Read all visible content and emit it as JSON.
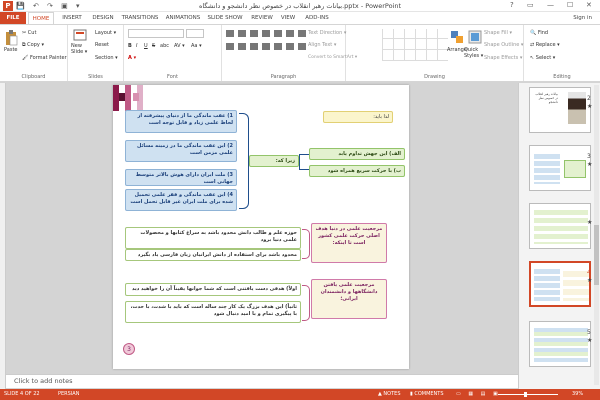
{
  "window": {
    "title": "بیانات رهبر انقلاب در خصوص نظر دانشجو و دانشگاه.pptx - PowerPoint",
    "quick_access": "💾 ↶ ↷ ▣ ▾",
    "controls": {
      "help": "?",
      "restore": "▭",
      "minimize": "—",
      "maximize": "☐",
      "close": "✕"
    },
    "user": "Sign in"
  },
  "tabs": [
    "FILE",
    "HOME",
    "INSERT",
    "DESIGN",
    "TRANSITIONS",
    "ANIMATIONS",
    "SLIDE SHOW",
    "REVIEW",
    "VIEW",
    "ADD-INS"
  ],
  "active_tab": "HOME",
  "ribbon": {
    "clipboard": {
      "label": "Clipboard",
      "paste": "Paste",
      "cut": "Cut",
      "copy": "Copy ▾",
      "format_painter": "Format Painter"
    },
    "slides": {
      "label": "Slides",
      "new_slide": "New Slide ▾",
      "layout": "Layout ▾",
      "reset": "Reset",
      "section": "Section ▾"
    },
    "font": {
      "label": "Font",
      "bold": "B",
      "italic": "I",
      "underline": "U",
      "strike": "S",
      "abc": "abc",
      "spacing": "AV ▾",
      "case": "Aa ▾",
      "color": "A ▾"
    },
    "paragraph": {
      "label": "Paragraph",
      "text_direction": "Text Direction ▾",
      "align_text": "Align Text ▾",
      "smartart": "Convert to SmartArt ▾"
    },
    "drawing": {
      "label": "Drawing",
      "arrange": "Arrange",
      "quick_styles": "Quick Styles ▾",
      "shape_fill": "Shape Fill ▾",
      "shape_outline": "Shape Outline ▾",
      "shape_effects": "Shape Effects ▾"
    },
    "editing": {
      "label": "Editing",
      "find": "Find",
      "replace": "Replace ▾",
      "select": "Select ▾"
    }
  },
  "slide": {
    "header": "لذا باید:",
    "center_label": "زیرا که:",
    "left_points": [
      "1) عقب ماندگی ما از دنیای پیشرفته از لحاظ علمی زیاد و قابل توجه است",
      "2) این عقب ماندگی ما در زمینه مسائل علمی مزمن است",
      "3) ملت ایران دارای هوش بالاتر متوسط جهانی است",
      "4) این عقب ماندگی و فقر علمی تحمیل شده برای ملت ایران غیر قابل تحمل است"
    ],
    "right_points": [
      "الف) این جهش تداوم یابد",
      "ب) با حرکت سریع همراه شود"
    ],
    "middle_text": "حوزه علم و طالب دانش محدود باشد به سراغ کتابها و محصولات علمی  دنیا برود",
    "middle_text_2": "محدود باشد برای استفاده از دانش ایرانیان زبان فارسی یاد بگیرد",
    "goal_1": "مرجعیت علمی در دنیا هدف اصلی حرکت علمی کشور است تا اینکه:",
    "lower_text_1": "اولاً) هدفی دست یافتنی است که شما جوانها یقیناً آن را خواهید دید",
    "lower_text_2": "ثانیاً) این هدف بزرگ یک کار چند ساله است که باید با شدت، با حدت، با پیگیری تمام و با امید دنبال شود",
    "goal_2": "مرجعیت علمی یافتن دانشگاهها و دانشمندان ایرانی؛",
    "page_number": "3"
  },
  "thumbnails": [
    {
      "number": "2",
      "star": "★",
      "caption": "بیانات رهبر انقلاب در خصوص نظر دانشجو"
    },
    {
      "number": "3",
      "star": "★"
    },
    {
      "number": "",
      "star": "★"
    },
    {
      "number": "4",
      "star": "★",
      "selected": true
    },
    {
      "number": "5",
      "star": "★"
    }
  ],
  "notes_placeholder": "Click to add notes",
  "status": {
    "slide": "SLIDE 4 OF 22",
    "language": "PERSIAN",
    "notes": "▲ NOTES",
    "comments": "▮ COMMENTS",
    "zoom": "39%"
  },
  "colors": {
    "accent": "#d24726",
    "connector": "#1f4e8c"
  }
}
